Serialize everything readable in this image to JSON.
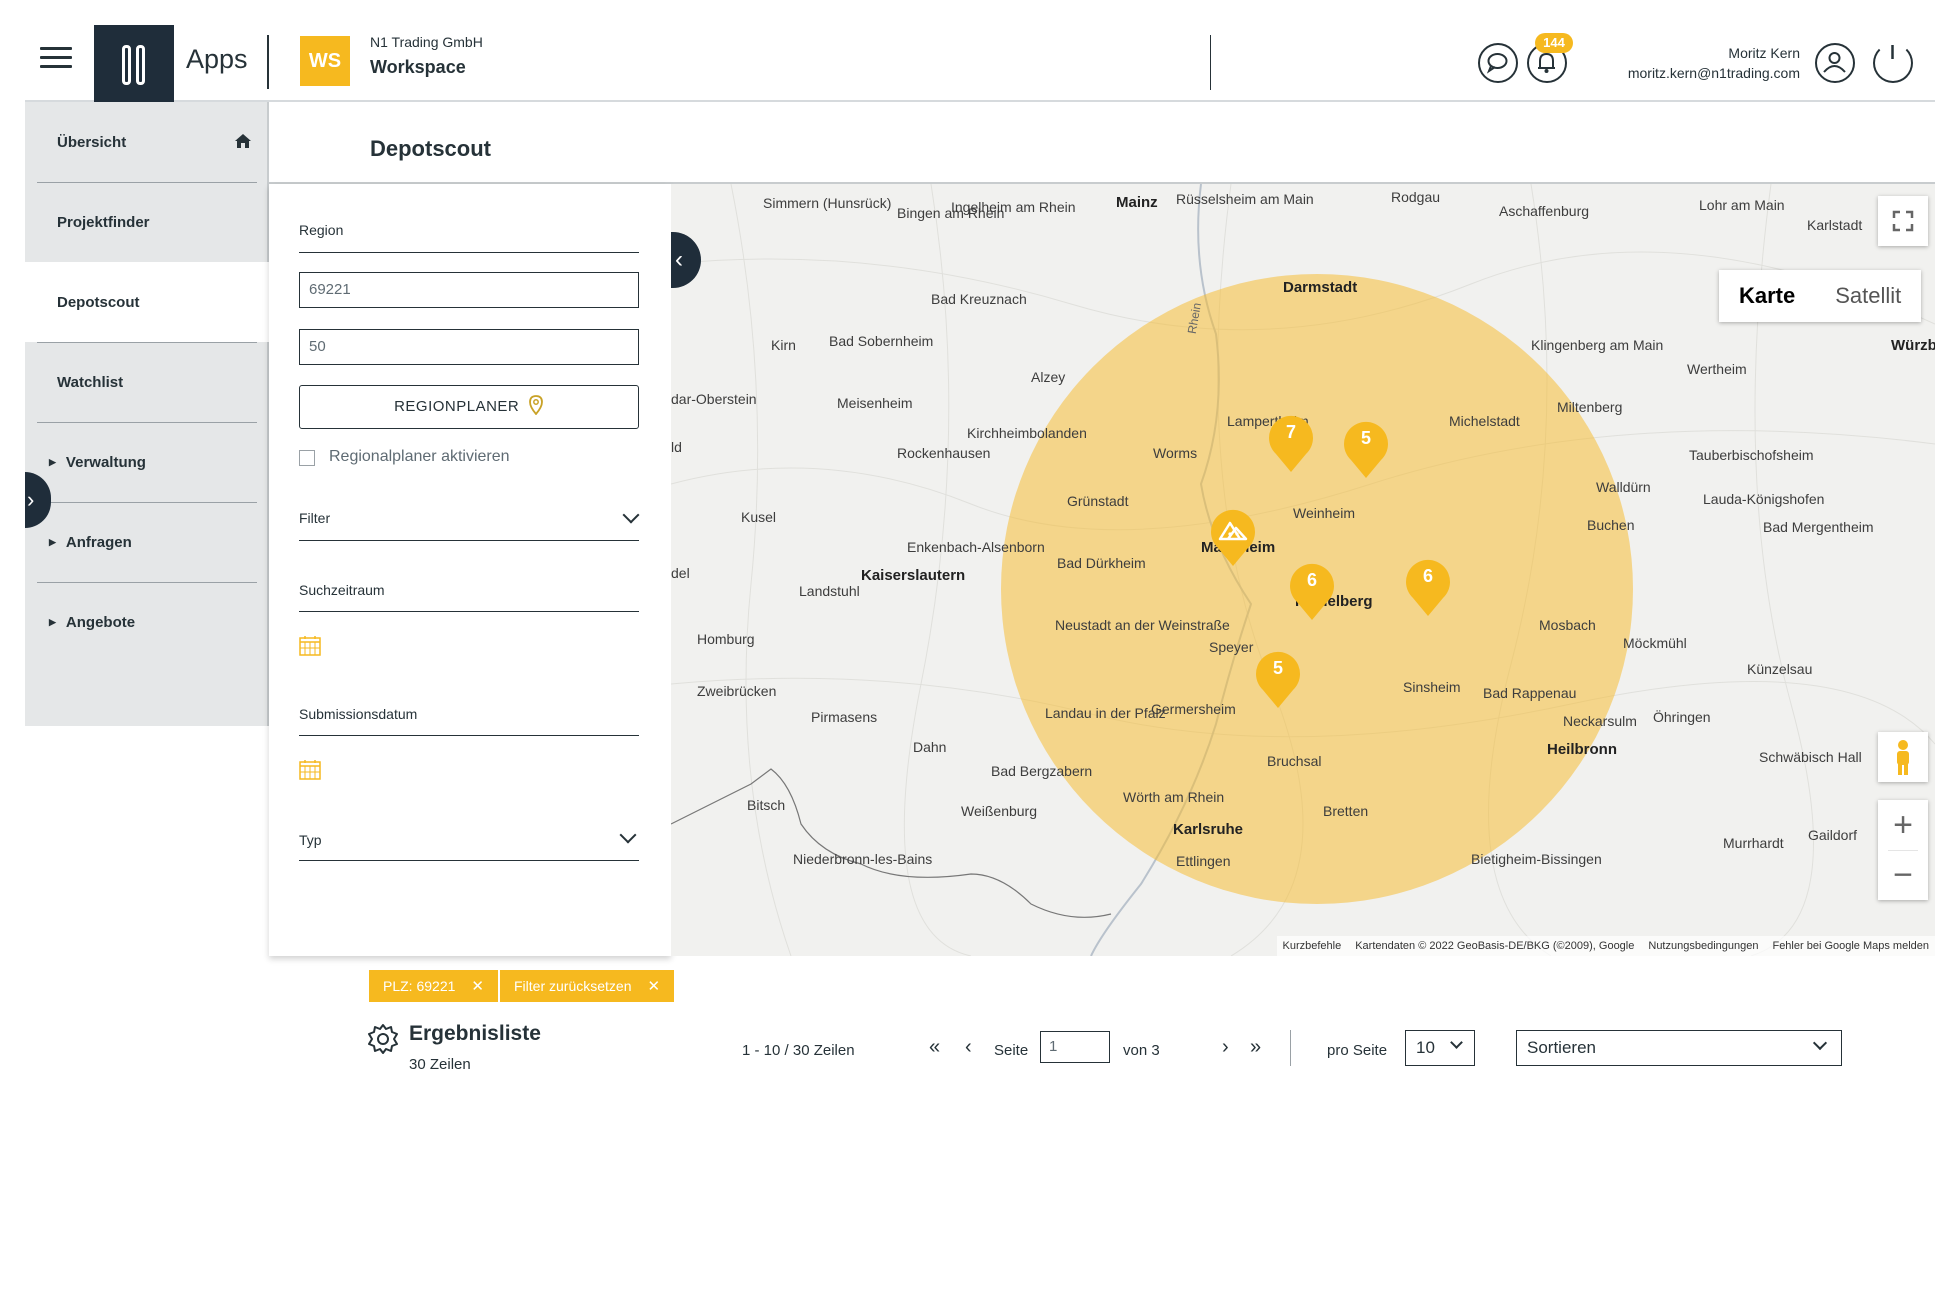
{
  "header": {
    "apps_label": "Apps",
    "workspace_badge": "WS",
    "company": "N1 Trading GmbH",
    "workspace": "Workspace",
    "notification_count": "144",
    "user_name": "Moritz Kern",
    "user_email": "moritz.kern@n1trading.com",
    "icons": [
      "menu-icon",
      "chat-icon",
      "bell-icon",
      "user-icon",
      "power-icon"
    ]
  },
  "sidebar": {
    "items": [
      {
        "label": "Übersicht"
      },
      {
        "label": "Projektfinder"
      },
      {
        "label": "Depotscout"
      },
      {
        "label": "Watchlist"
      },
      {
        "label": "Verwaltung"
      },
      {
        "label": "Anfragen"
      },
      {
        "label": "Angebote"
      }
    ],
    "active": "Depotscout"
  },
  "page": {
    "title": "Depotscout"
  },
  "filter": {
    "region_label": "Region",
    "zip_value": "69221",
    "radius_value": "50",
    "regionplaner_button": "REGIONPLANER",
    "regionplaner_checkbox_label": "Regionalplaner aktivieren",
    "filter_label": "Filter",
    "period_label": "Suchzeitraum",
    "submission_label": "Submissionsdatum",
    "type_label": "Typ"
  },
  "map": {
    "type_options": [
      "Karte",
      "Satellit"
    ],
    "selected_type": "Karte",
    "clusters": [
      {
        "count": "7"
      },
      {
        "count": "5"
      },
      {
        "count": "6"
      },
      {
        "count": "6"
      },
      {
        "count": "5"
      }
    ],
    "center_marker": "home-location",
    "cities": [
      "Simmern (Hunsrück)",
      "Bingen am Rhein",
      "Ingelheim am Rhein",
      "Mainz",
      "Rüsselsheim am Main",
      "Rodgau",
      "Aschaffenburg",
      "Lohr am Main",
      "Karlstadt",
      "Darmstadt",
      "Bad Kreuznach",
      "Kirn",
      "Bad Sobernheim",
      "Alzey",
      "Klingenberg am Main",
      "Wertheim",
      "Würzbu",
      "dar-Oberstein",
      "Meisenheim",
      "Miltenberg",
      "Michelstadt",
      "Kirchheimbolanden",
      "Rockenhausen",
      "Worms",
      "Tauberbischofsheim",
      "Walldürn",
      "Lauda-Königshofen",
      "Grünstadt",
      "Weinheim",
      "Kusel",
      "Buchen",
      "Enkenbach-Alsenborn",
      "Bad Dürkheim",
      "Mannheim",
      "Bad Mergentheim",
      "Kaiserslautern",
      "Landstuhl",
      "Heidelberg",
      "Neustadt an der Weinstraße",
      "Mosbach",
      "Möckmühl",
      "Homburg",
      "Speyer",
      "Künzelsau",
      "Zweibrücken",
      "Pirmasens",
      "Sinsheim",
      "Bad Rappenau",
      "Germersheim",
      "Landau in der Pfalz",
      "Neckarsulm",
      "Öhringen",
      "Dahn",
      "Heilbronn",
      "Schwäbisch Hall",
      "Bruchsal",
      "Bad Bergzabern",
      "Bitsch",
      "Wörth am Rhein",
      "Weißenburg",
      "Bretten",
      "Karlsruhe",
      "Gaildorf",
      "Murrhardt",
      "Niederbronn-les-Bains",
      "Ettlingen",
      "Bietigheim-Bissingen",
      "Rhein",
      "Lampertheim",
      "ld",
      "del"
    ],
    "footer": [
      "Kurzbefehle",
      "Kartendaten © 2022 GeoBasis-DE/BKG (©2009), Google",
      "Nutzungsbedingungen",
      "Fehler bei Google Maps melden"
    ]
  },
  "chips": [
    {
      "label": "PLZ: 69221"
    },
    {
      "label": "Filter zurücksetzen"
    }
  ],
  "results": {
    "title": "Ergebnisliste",
    "count": "30  Zeilen",
    "range": "1 - 10 / 30  Zeilen",
    "page_label": "Seite",
    "page_value": "1",
    "of_label": "von 3",
    "per_page_label": "pro Seite",
    "per_page_value": "10",
    "sort_placeholder": "Sortieren"
  },
  "colors": {
    "accent": "#f6b91f",
    "dark": "#1f2d3a",
    "sidebar_bg": "#e5e7e8"
  }
}
